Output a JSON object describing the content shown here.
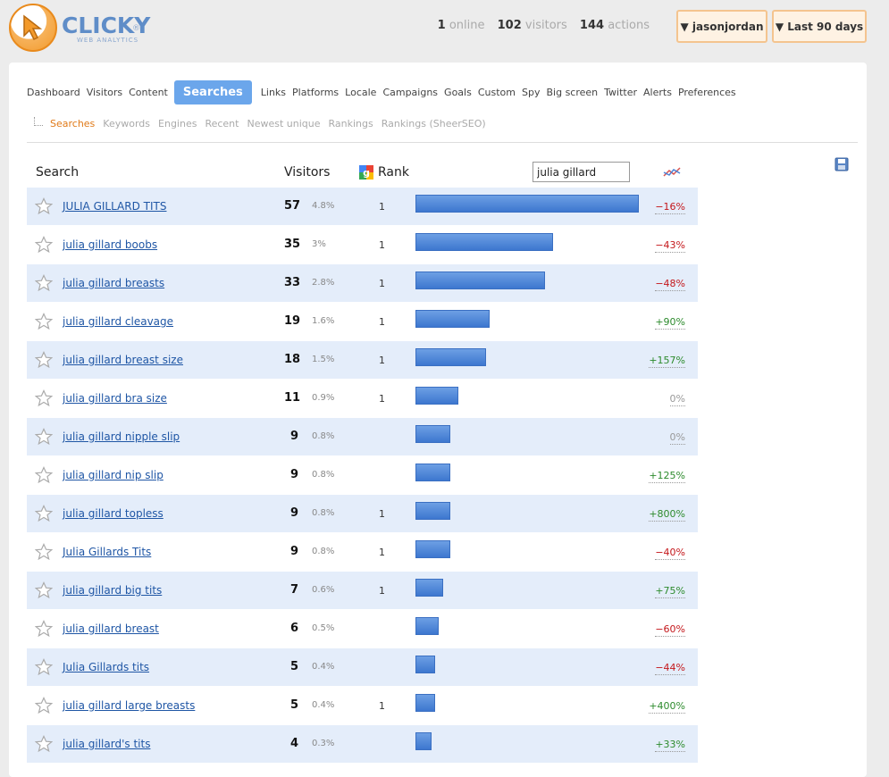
{
  "header": {
    "logo_text": "CLICKY",
    "logo_sub": "WEB ANALYTICS",
    "logo_reg": "®",
    "stats": [
      {
        "num": "1",
        "label": "online"
      },
      {
        "num": "102",
        "label": "visitors"
      },
      {
        "num": "144",
        "label": "actions"
      }
    ],
    "user_button": "▼ jasonjordan",
    "range_button": "▼ Last 90 days"
  },
  "nav": {
    "tabs": [
      "Dashboard",
      "Visitors",
      "Content",
      "Searches",
      "Links",
      "Platforms",
      "Locale",
      "Campaigns",
      "Goals",
      "Custom",
      "Spy",
      "Big screen",
      "Twitter",
      "Alerts",
      "Preferences"
    ],
    "active": "Searches",
    "subtabs": [
      "Searches",
      "Keywords",
      "Engines",
      "Recent",
      "Newest unique",
      "Rankings",
      "Rankings (SheerSEO)"
    ],
    "active_sub": "Searches"
  },
  "table": {
    "col_search": "Search",
    "col_visitors": "Visitors",
    "col_rank": "Rank",
    "filter_value": "julia gillard",
    "max_visitors": 57,
    "rows": [
      {
        "term": "JULIA GILLARD TITS",
        "visitors": "57",
        "pct": "4.8%",
        "rank": "1",
        "change": "−16%",
        "trend": "down"
      },
      {
        "term": "julia gillard boobs",
        "visitors": "35",
        "pct": "3%",
        "rank": "1",
        "change": "−43%",
        "trend": "down"
      },
      {
        "term": "julia gillard breasts",
        "visitors": "33",
        "pct": "2.8%",
        "rank": "1",
        "change": "−48%",
        "trend": "down"
      },
      {
        "term": "julia gillard cleavage",
        "visitors": "19",
        "pct": "1.6%",
        "rank": "1",
        "change": "+90%",
        "trend": "up"
      },
      {
        "term": "julia gillard breast size",
        "visitors": "18",
        "pct": "1.5%",
        "rank": "1",
        "change": "+157%",
        "trend": "up"
      },
      {
        "term": "julia gillard bra size",
        "visitors": "11",
        "pct": "0.9%",
        "rank": "1",
        "change": "0%",
        "trend": "flat"
      },
      {
        "term": "julia gillard nipple slip",
        "visitors": "9",
        "pct": "0.8%",
        "rank": "",
        "change": "0%",
        "trend": "flat"
      },
      {
        "term": "julia gillard nip slip",
        "visitors": "9",
        "pct": "0.8%",
        "rank": "",
        "change": "+125%",
        "trend": "up"
      },
      {
        "term": "julia gillard topless",
        "visitors": "9",
        "pct": "0.8%",
        "rank": "1",
        "change": "+800%",
        "trend": "up"
      },
      {
        "term": "Julia Gillards Tits",
        "visitors": "9",
        "pct": "0.8%",
        "rank": "1",
        "change": "−40%",
        "trend": "down"
      },
      {
        "term": "julia gillard big tits",
        "visitors": "7",
        "pct": "0.6%",
        "rank": "1",
        "change": "+75%",
        "trend": "up"
      },
      {
        "term": "julia gillard breast",
        "visitors": "6",
        "pct": "0.5%",
        "rank": "",
        "change": "−60%",
        "trend": "down"
      },
      {
        "term": "Julia Gillards tits",
        "visitors": "5",
        "pct": "0.4%",
        "rank": "",
        "change": "−44%",
        "trend": "down"
      },
      {
        "term": "julia gillard large breasts",
        "visitors": "5",
        "pct": "0.4%",
        "rank": "1",
        "change": "+400%",
        "trend": "up"
      },
      {
        "term": "julia gillard's tits",
        "visitors": "4",
        "pct": "0.3%",
        "rank": "",
        "change": "+33%",
        "trend": "up"
      }
    ]
  },
  "colors": {
    "accent": "#6ba6eb",
    "row_alt": "#e4edfa",
    "bar": "#4a82d6",
    "down": "#c4171b",
    "up": "#2d8b2d",
    "orange": "#e07a19"
  }
}
